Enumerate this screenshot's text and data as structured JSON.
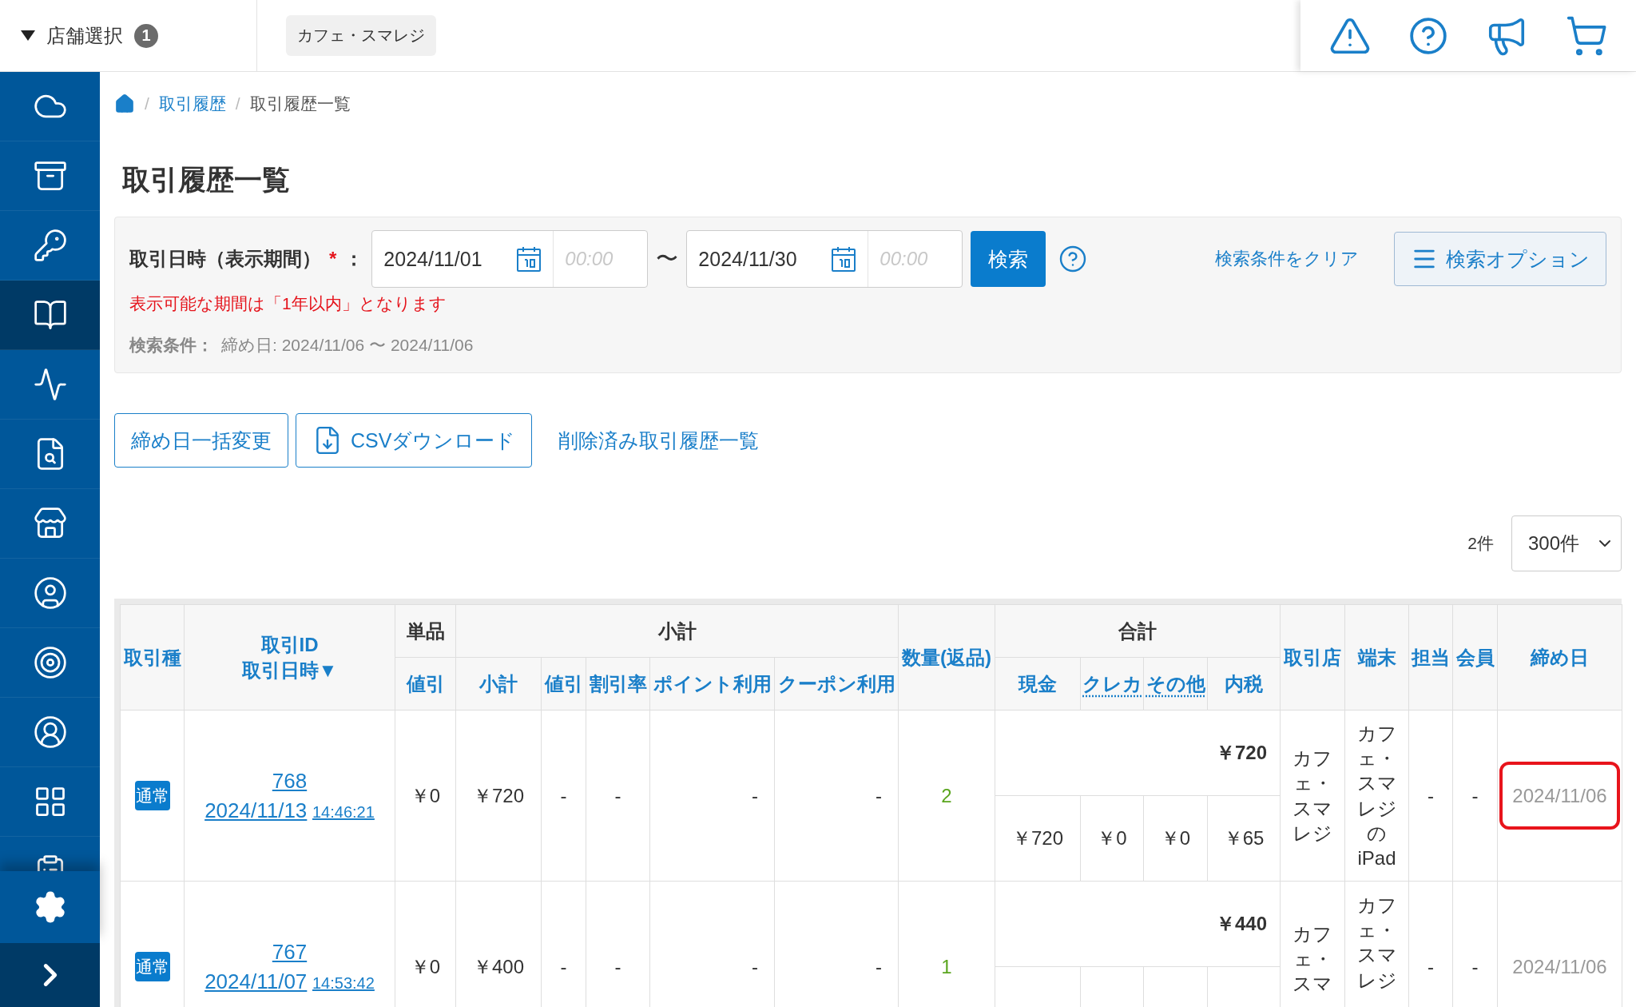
{
  "header": {
    "store_selector": {
      "label": "店舗選択",
      "count": "1"
    },
    "store_chip": "カフェ・スマレジ"
  },
  "sidebar": {
    "items": [
      {
        "selected": false
      },
      {
        "selected": false
      },
      {
        "selected": false
      },
      {
        "selected": true
      },
      {
        "selected": false
      },
      {
        "selected": false
      },
      {
        "selected": false
      },
      {
        "selected": false
      },
      {
        "selected": false
      },
      {
        "selected": false
      },
      {
        "selected": false
      },
      {
        "selected": false
      }
    ]
  },
  "breadcrumb_separator": "/",
  "breadcrumb": [
    {
      "kind": "home"
    },
    {
      "kind": "link",
      "label": "取引履歴"
    },
    {
      "kind": "current",
      "label": "取引履歴一覧"
    }
  ],
  "page_title": "取引履歴一覧",
  "search": {
    "label": "取引日時（表示期間）",
    "required_mark": "*",
    "colon": "：",
    "from": {
      "date": "2024/11/01",
      "time_placeholder": "00:00"
    },
    "separator": "〜",
    "to": {
      "date": "2024/11/30",
      "time_placeholder": "00:00"
    },
    "search_button": "検索",
    "clear_link": "検索条件をクリア",
    "options_button": "検索オプション",
    "error": "表示可能な期間は「1年以内」となります",
    "conditions_label": "検索条件：",
    "conditions": "締め日: 2024/11/06 〜 2024/11/06"
  },
  "actions": [
    {
      "kind": "button",
      "label": "締め日一括変更"
    },
    {
      "kind": "download",
      "label": "CSVダウンロード"
    },
    {
      "kind": "link",
      "label": "削除済み取引履歴一覧"
    }
  ],
  "result_count": "2件",
  "page_size": "300件",
  "table": {
    "columns": [
      {
        "label": "取引種"
      },
      {
        "label": "取引ID",
        "sublabel": "取引日時▼"
      },
      {
        "label": "単品",
        "children": [
          {
            "label": "値引"
          }
        ]
      },
      {
        "label": "小計",
        "children": [
          {
            "label": "小計"
          },
          {
            "label": "値引"
          },
          {
            "label": "割引率"
          },
          {
            "label": "ポイント利用"
          },
          {
            "label": "クーポン利用"
          }
        ]
      },
      {
        "label": "数量(返品)"
      },
      {
        "label": "合計",
        "children": [
          {
            "label": "現金"
          },
          {
            "label": "クレカ",
            "underlined": true
          },
          {
            "label": "その他",
            "underlined": true
          },
          {
            "label": "内税"
          }
        ]
      },
      {
        "label": "取引店"
      },
      {
        "label": "端末"
      },
      {
        "label": "担当"
      },
      {
        "label": "会員"
      },
      {
        "label": "締め日"
      }
    ],
    "rows": [
      {
        "type": "通常",
        "id": "768",
        "date": "2024/11/13",
        "time": "14:46:21",
        "item_discount": "￥0",
        "subtotal": "￥720",
        "discount": "-",
        "discount_rate": "-",
        "points": "-",
        "coupon": "-",
        "quantity": "2",
        "total": "￥720",
        "breakdown": [
          "￥720",
          "￥0",
          "￥0",
          "￥65"
        ],
        "store": "カフェ・スマレジ",
        "terminal": "カフェ・スマレジのiPad",
        "staff": "-",
        "member": "-",
        "closing_date": "2024/11/06",
        "highlighted": true
      },
      {
        "type": "通常",
        "id": "767",
        "date": "2024/11/07",
        "time": "14:53:42",
        "item_discount": "￥0",
        "subtotal": "￥400",
        "discount": "-",
        "discount_rate": "-",
        "points": "-",
        "coupon": "-",
        "quantity": "1",
        "total": "￥440",
        "store": "カフェ・スマ",
        "terminal": "カフェ・スマレジ",
        "staff": "-",
        "member": "-",
        "closing_date": "2024/11/06",
        "highlighted": false
      }
    ]
  }
}
